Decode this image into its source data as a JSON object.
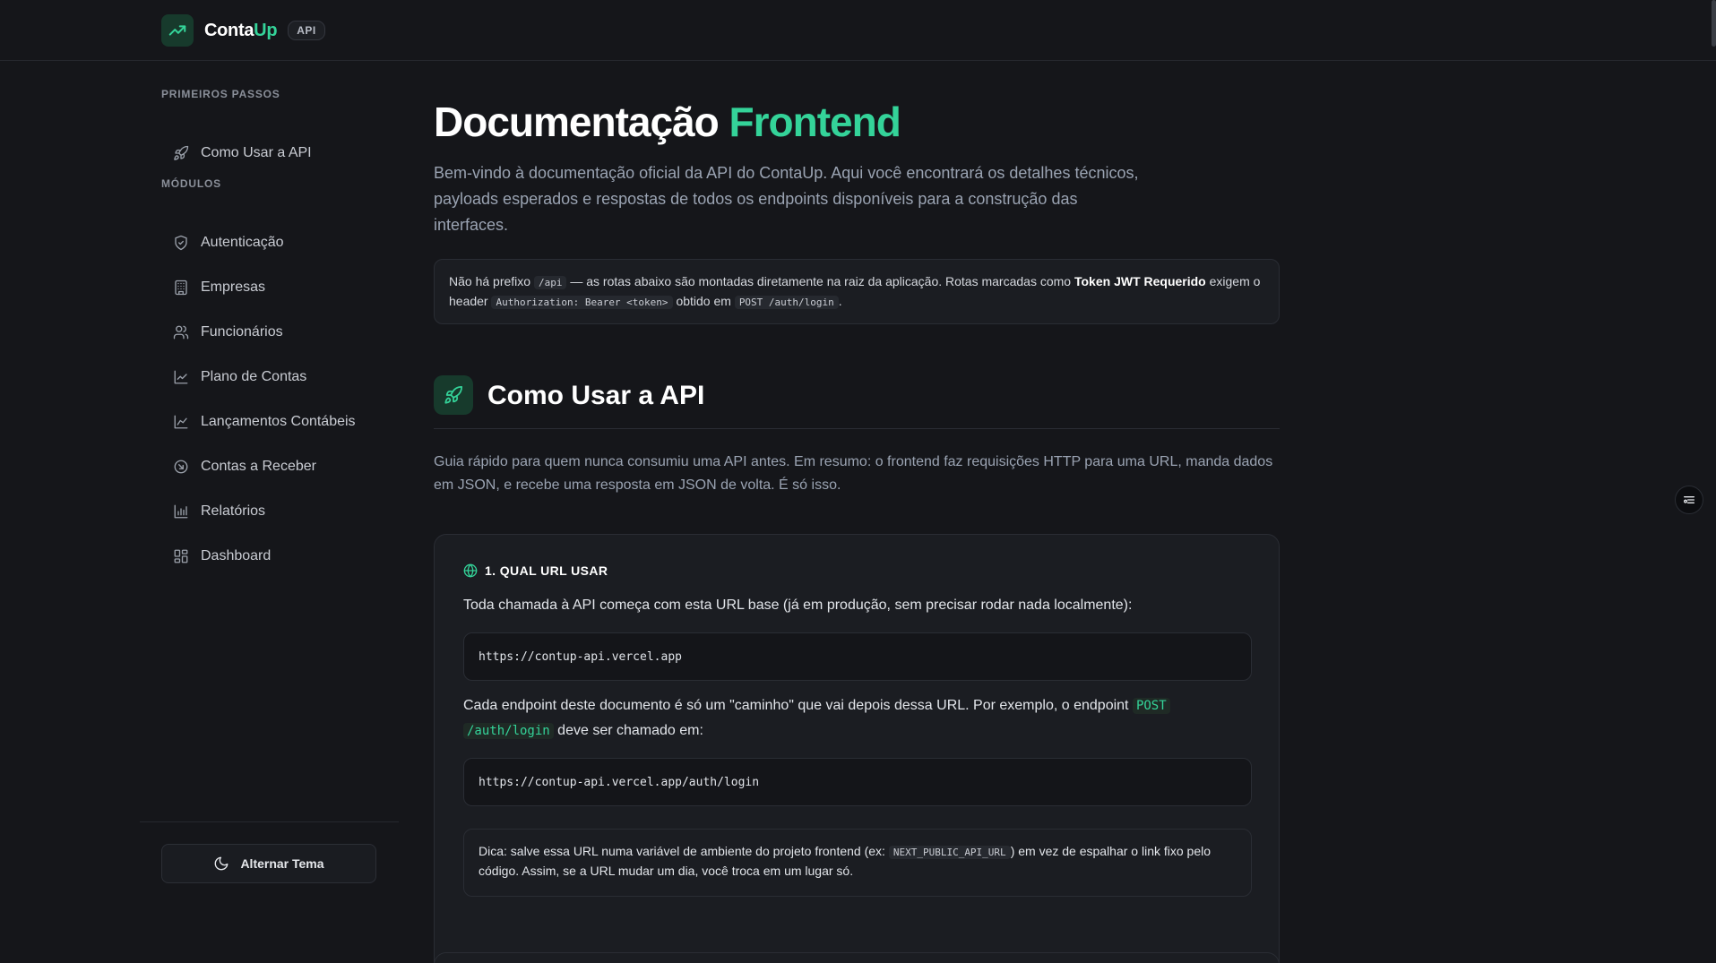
{
  "header": {
    "brand_primary": "Conta",
    "brand_accent": "Up",
    "badge": "API",
    "logo_icon": "trending-up-icon"
  },
  "sidebar": {
    "section_getting_started": "PRIMEIROS PASSOS",
    "getting_started_items": [
      {
        "label": "Como Usar a API",
        "icon": "rocket-icon"
      }
    ],
    "section_modules": "MÓDULOS",
    "module_items": [
      {
        "label": "Autenticação",
        "icon": "shield-icon"
      },
      {
        "label": "Empresas",
        "icon": "building-icon"
      },
      {
        "label": "Funcionários",
        "icon": "users-icon"
      },
      {
        "label": "Plano de Contas",
        "icon": "line-chart-icon"
      },
      {
        "label": "Lançamentos Contábeis",
        "icon": "line-chart-icon"
      },
      {
        "label": "Contas a Receber",
        "icon": "arrow-circle-icon"
      },
      {
        "label": "Relatórios",
        "icon": "bar-chart-icon"
      },
      {
        "label": "Dashboard",
        "icon": "dashboard-icon"
      }
    ],
    "theme_button": "Alternar Tema"
  },
  "main": {
    "title_part1": "Documentação",
    "title_part2": "Frontend",
    "intro": "Bem-vindo à documentação oficial da API do ContaUp. Aqui você encontrará os detalhes técnicos, payloads esperados e respostas de todos os endpoints disponíveis para a construção das interfaces.",
    "note": {
      "t1": "Não há prefixo",
      "c1": "/api",
      "t2": "— as rotas abaixo são montadas diretamente na raiz da aplicação. Rotas marcadas como",
      "strong": "Token JWT Requerido",
      "t3": "exigem o header",
      "c2": "Authorization: Bearer <token>",
      "t4": "obtido em",
      "c3": "POST /auth/login",
      "t5": "."
    },
    "section": {
      "title": "Como Usar a API",
      "description": "Guia rápido para quem nunca consumiu uma API antes. Em resumo: o frontend faz requisições HTTP para uma URL, manda dados em JSON, e recebe uma resposta em JSON de volta. É só isso."
    },
    "card": {
      "heading": "1. QUAL URL USAR",
      "text1": "Toda chamada à API começa com esta URL base (já em produção, sem precisar rodar nada localmente):",
      "code1": "https://contup-api.vercel.app",
      "text2a": "Cada endpoint deste documento é só um \"caminho\" que vai depois dessa URL. Por exemplo, o endpoint",
      "text2_code_a": "POST",
      "text2_code_b": "/auth/login",
      "text2b": "deve ser chamado em:",
      "code2": "https://contup-api.vercel.app/auth/login",
      "tip_a": "Dica: salve essa URL numa variável de ambiente do projeto frontend (ex:",
      "tip_code": "NEXT_PUBLIC_API_URL",
      "tip_b": ") em vez de espalhar o link fixo pelo código. Assim, se a URL mudar um dia, você troca em um lugar só."
    }
  },
  "colors": {
    "accent": "#34d399",
    "background": "#15161a",
    "card": "#1b1d22"
  }
}
